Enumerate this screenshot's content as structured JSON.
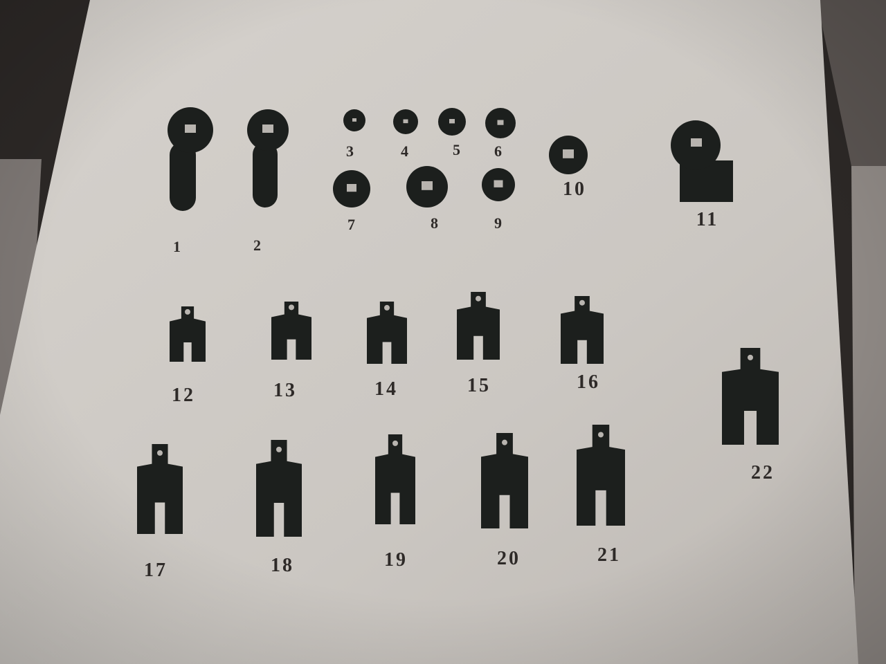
{
  "scene": {
    "description_hidden": false,
    "colors": {
      "board": "#cfcbc6",
      "wall_dark": "#2c2826",
      "wall_mid": "#8f8985",
      "coin": "#1c1f1d",
      "label": "#2e2a28"
    }
  },
  "labels": [
    "1",
    "2",
    "3",
    "4",
    "5",
    "6",
    "7",
    "8",
    "9",
    "10",
    "11",
    "12",
    "13",
    "14",
    "15",
    "16",
    "17",
    "18",
    "19",
    "20",
    "21",
    "22"
  ]
}
